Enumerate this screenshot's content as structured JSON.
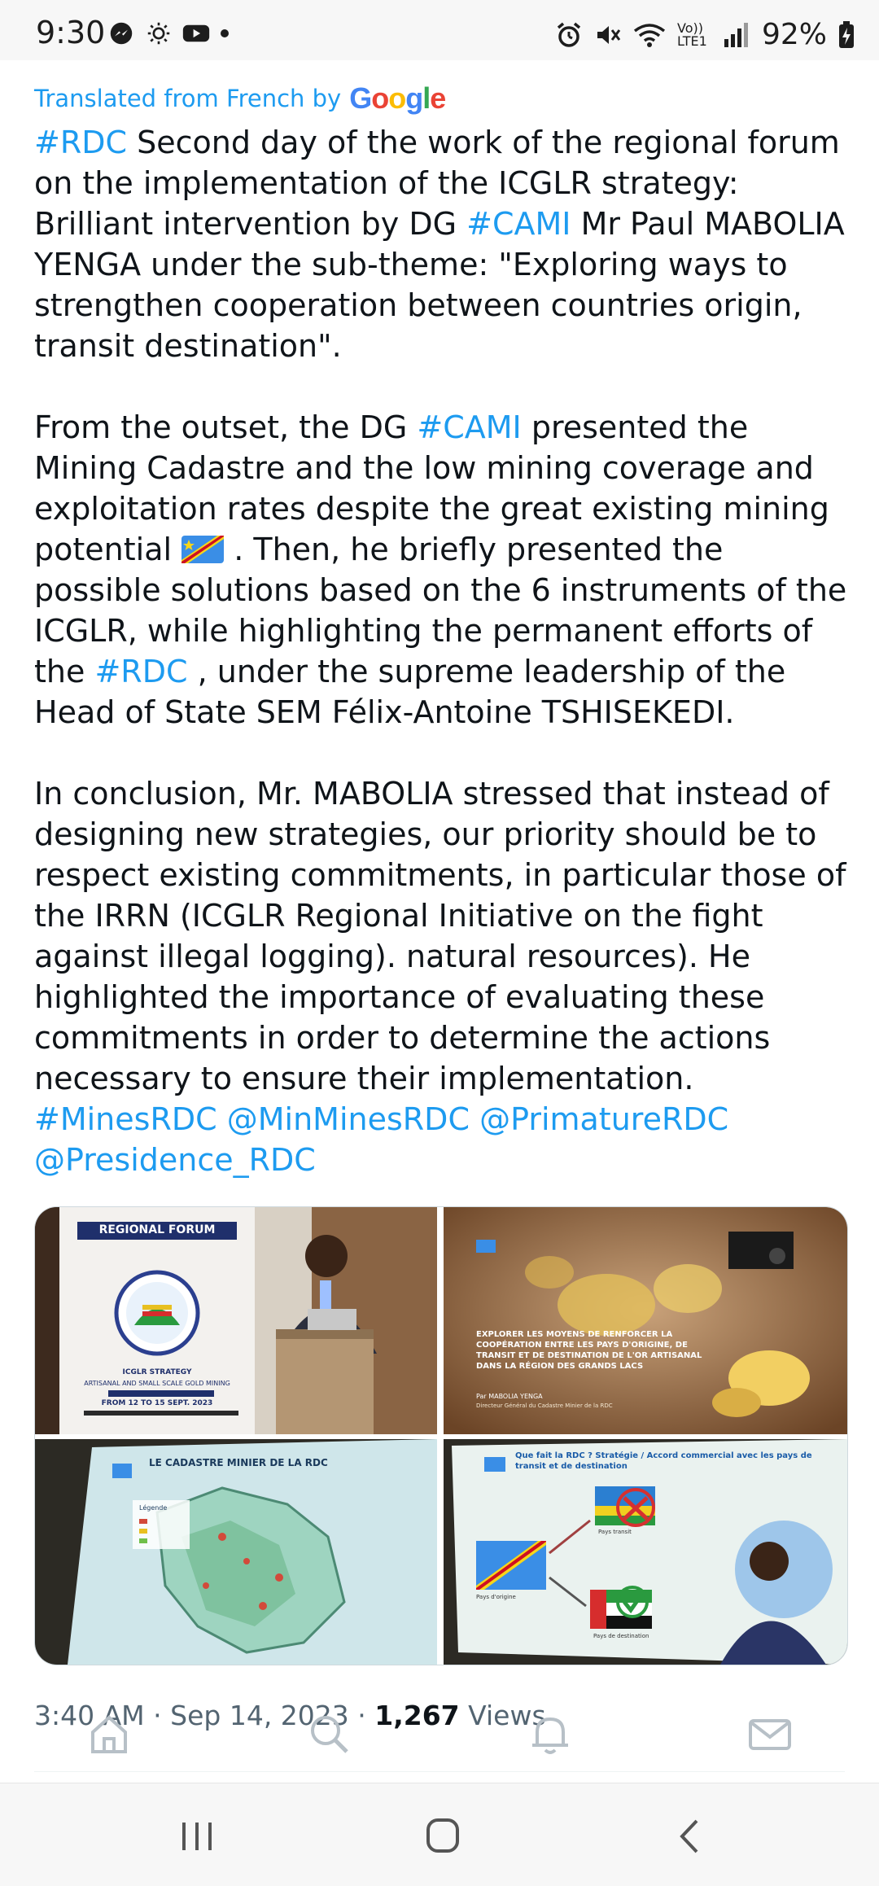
{
  "status_bar": {
    "time": "9:30",
    "left_icons": [
      "messenger-icon",
      "brightness-icon",
      "youtube-icon",
      "dot-icon"
    ],
    "right_icons": [
      "alarm-icon",
      "mute-icon",
      "wifi-icon",
      "volte-icon",
      "signal-icon"
    ],
    "volte_label": "Vo)) LTE1",
    "battery": "92%"
  },
  "translation": {
    "label": "Translated from French by",
    "provider": "Google"
  },
  "tweet": {
    "p1": {
      "h1": "#RDC",
      "t1": " Second day of the work of the regional forum on the implementation of the ICGLR strategy: Brilliant intervention by DG ",
      "h2": "#CAMI",
      "t2": " Mr Paul MABOLIA YENGA under the sub-theme: \"Exploring ways to strengthen cooperation between countries origin, transit destination\"."
    },
    "p2": {
      "t1": "From the outset, the DG ",
      "h1": "#CAMI",
      "t2": " presented the Mining Cadastre and the low mining coverage and exploitation rates despite the great existing mining potential ",
      "t3": " . Then, he briefly presented the possible solutions based on the 6 instruments of the ICGLR, while highlighting the permanent efforts of the ",
      "h2": "#RDC",
      "t4": " , under the supreme leadership of the Head of State SEM Félix-Antoine TSHISEKEDI."
    },
    "p3": {
      "t1": "In conclusion, Mr. MABOLIA stressed that instead of designing new strategies, our priority should be to respect existing commitments, in particular those of the IRRN (ICGLR Regional Initiative on the fight against illegal logging). natural resources). He highlighted the importance of evaluating these commitments in order to determine the actions necessary to ensure their implementation.",
      "tags": [
        "#MinesRDC",
        "@MinMinesRDC",
        "@PrimatureRDC",
        "@Presidence_RDC"
      ]
    }
  },
  "media": {
    "photo1": {
      "banner": "REGIONAL FORUM",
      "strategy": "ICGLR STRATEGY",
      "subtitle": "ARTISANAL AND SMALL SCALE GOLD MINING",
      "dates": "FROM 12 TO 15 SEPT. 2023"
    },
    "photo2": {
      "slide_title": "EXPLORER LES MOYENS DE RENFORCER LA COOPÉRATION ENTRE LES PAYS D'ORIGINE, DE TRANSIT ET DE DESTINATION DE L'OR ARTISANAL DANS LA RÉGION DES GRANDS LACS",
      "by": "Par MABOLIA YENGA",
      "role": "Directeur Général du Cadastre Minier de la RDC"
    },
    "photo3": {
      "slide_title": "LE CADASTRE MINIER DE LA RDC",
      "legend_title": "Légende"
    },
    "photo4": {
      "slide_title": "Que fait la RDC ? Stratégie / Accord commercial avec les pays de transit et de destination",
      "origin": "Pays d'origine",
      "transit": "Pays transit",
      "destination": "Pays de destination"
    }
  },
  "meta": {
    "time": "3:40 AM",
    "dot1": " · ",
    "date": "Sep 14, 2023",
    "dot2": " · ",
    "views": "1,267",
    "views_label": " Views"
  },
  "tab_bar": [
    "home-icon",
    "search-icon",
    "notifications-icon",
    "messages-icon"
  ],
  "nav_bar": [
    "recent-apps-icon",
    "home-button-icon",
    "back-icon"
  ],
  "colors": {
    "accent": "#1d9bf0",
    "text": "#0f1419",
    "muted": "#536471"
  }
}
